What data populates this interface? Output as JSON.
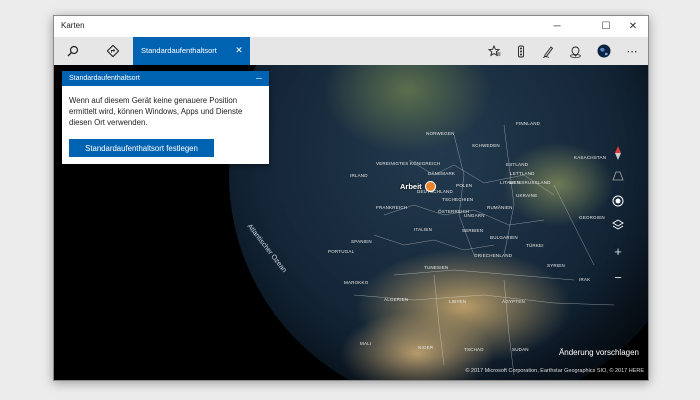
{
  "window": {
    "title": "Karten",
    "minimize_glyph": "─",
    "maximize_glyph": "☐",
    "close_glyph": "✕"
  },
  "toolbar": {
    "left_icons": [
      "search-icon",
      "directions-icon"
    ],
    "tab": {
      "label": "Standardaufenthaltsort",
      "close_glyph": "✕"
    },
    "right_icons": [
      "favorites-icon",
      "traffic-icon",
      "ink-pen-icon",
      "3d-cities-icon",
      "globe-icon",
      "more-icon"
    ],
    "more_glyph": "⋯"
  },
  "card": {
    "title": "Standardaufenthaltsort",
    "minimize_glyph": "─",
    "body": "Wenn auf diesem Gerät keine genauere Position ermittelt wird, können Windows, Apps und Dienste diesen Ort verwenden.",
    "button_label": "Standardaufenthaltsort festlegen"
  },
  "map": {
    "pin_label": "Arbeit",
    "ocean_label": "Atlantischer Ozean",
    "places": [
      "NORWEGEN",
      "SCHWEDEN",
      "FINNLAND",
      "ESTLAND",
      "LETTLAND",
      "LITAUEN",
      "DÄNEMARK",
      "VEREINIGTES KÖNIGREICH",
      "IRLAND",
      "POLEN",
      "WEISSRUSSLAND",
      "UKRAINE",
      "TSCHECHIEN",
      "DEUTSCHLAND",
      "FRANKREICH",
      "ÖSTERREICH",
      "UNGARN",
      "RUMÄNIEN",
      "SPANIEN",
      "PORTUGAL",
      "ITALIEN",
      "SERBIEN",
      "BULGARIEN",
      "TÜRKEI",
      "GRIECHENLAND",
      "SYRIEN",
      "IRAK",
      "TUNESIEN",
      "MAROKKO",
      "ALGERIEN",
      "LIBYEN",
      "ÄGYPTEN",
      "MALI",
      "NIGER",
      "TSCHAD",
      "SUDAN",
      "GEORGIEN",
      "KASACHSTAN"
    ],
    "controls": [
      "compass-icon",
      "tilt-icon",
      "location-icon",
      "layers-icon",
      "zoom-in-icon",
      "zoom-out-icon"
    ],
    "zoom_in_glyph": "+",
    "zoom_out_glyph": "−",
    "feedback": "Änderung vorschlagen",
    "copyright": "© 2017 Microsoft Corporation, Earthstar Geographics SIO, © 2017 HERE"
  },
  "colors": {
    "accent": "#0063b1",
    "pin": "#e8842c"
  }
}
